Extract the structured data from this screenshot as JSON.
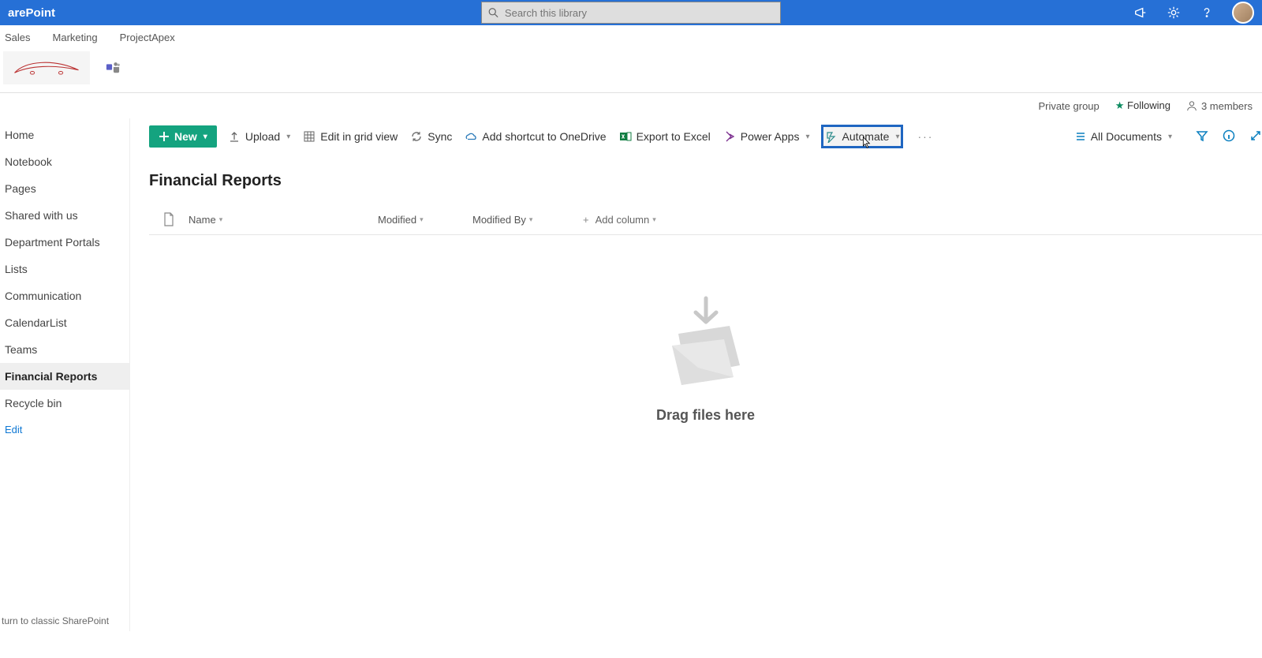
{
  "app_title": "arePoint",
  "search": {
    "placeholder": "Search this library"
  },
  "hubnav": [
    "Sales",
    "Marketing",
    "ProjectApex"
  ],
  "infobar": {
    "group_type": "Private group",
    "following_label": "Following",
    "members_label": "3 members"
  },
  "sidenav": {
    "items": [
      "Home",
      "Notebook",
      "Pages",
      "Shared with us",
      "Department Portals",
      "Lists",
      "Communication",
      "CalendarList",
      "Teams",
      "Financial Reports",
      "Recycle bin"
    ],
    "active_index": 9,
    "edit_label": "Edit",
    "classic_link": "turn to classic SharePoint"
  },
  "cmdbar": {
    "new_label": "New",
    "upload": "Upload",
    "editgrid": "Edit in grid view",
    "sync": "Sync",
    "shortcut": "Add shortcut to OneDrive",
    "export": "Export to Excel",
    "powerapps": "Power Apps",
    "automate": "Automate",
    "view_label": "All Documents"
  },
  "library": {
    "title": "Financial Reports",
    "cols": {
      "name": "Name",
      "modified": "Modified",
      "modified_by": "Modified By",
      "add": "Add column"
    },
    "empty_text": "Drag files here"
  }
}
